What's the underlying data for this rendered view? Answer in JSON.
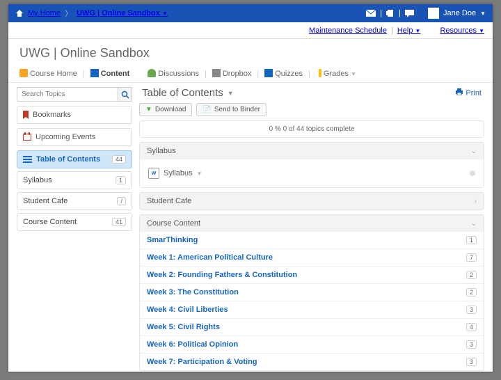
{
  "topbar": {
    "myhome": "My Home",
    "course": "UWG | Online Sandbox",
    "user": "Jane Doe"
  },
  "subbar": {
    "schedule": "Maintenance Schedule",
    "help": "Help",
    "resources": "Resources"
  },
  "page_title": "UWG | Online Sandbox",
  "coursenav": {
    "home": "Course Home",
    "content": "Content",
    "discussions": "Discussions",
    "dropbox": "Dropbox",
    "quizzes": "Quizzes",
    "grades": "Grades"
  },
  "search": {
    "placeholder": "Search Topics"
  },
  "side": {
    "bookmarks": "Bookmarks",
    "upcoming": "Upcoming Events",
    "items": [
      {
        "label": "Table of Contents",
        "count": "44",
        "active": true
      },
      {
        "label": "Syllabus",
        "count": "1"
      },
      {
        "label": "Student Cafe",
        "count": "/"
      },
      {
        "label": "Course Content",
        "count": "41"
      }
    ]
  },
  "main": {
    "heading": "Table of Contents",
    "print": "Print",
    "download": "Download",
    "binder": "Send to Binder",
    "progress": "0 %   0 of 44 topics complete",
    "syllabus_head": "Syllabus",
    "syllabus_topic": "Syllabus",
    "cafe_head": "Student Cafe",
    "cc_head": "Course Content",
    "cc_items": [
      {
        "label": "SmarThinking",
        "count": "1"
      },
      {
        "label": "Week 1: American Political Culture",
        "count": "7"
      },
      {
        "label": "Week 2: Founding Fathers & Constitution",
        "count": "2"
      },
      {
        "label": "Week 3: The Constitution",
        "count": "2"
      },
      {
        "label": "Week 4: Civil Liberties",
        "count": "3"
      },
      {
        "label": "Week 5: Civil Rights",
        "count": "4"
      },
      {
        "label": "Week 6: Political Opinion",
        "count": "3"
      },
      {
        "label": "Week 7: Participation & Voting",
        "count": "3"
      }
    ]
  }
}
